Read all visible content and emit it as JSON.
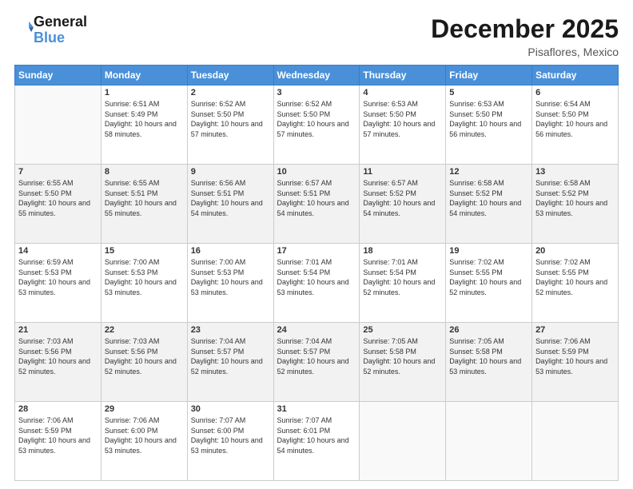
{
  "logo": {
    "line1": "General",
    "line2": "Blue"
  },
  "title": "December 2025",
  "location": "Pisaflores, Mexico",
  "days_of_week": [
    "Sunday",
    "Monday",
    "Tuesday",
    "Wednesday",
    "Thursday",
    "Friday",
    "Saturday"
  ],
  "weeks": [
    [
      {
        "day": "",
        "sunrise": "",
        "sunset": "",
        "daylight": ""
      },
      {
        "day": "1",
        "sunrise": "Sunrise: 6:51 AM",
        "sunset": "Sunset: 5:49 PM",
        "daylight": "Daylight: 10 hours and 58 minutes."
      },
      {
        "day": "2",
        "sunrise": "Sunrise: 6:52 AM",
        "sunset": "Sunset: 5:50 PM",
        "daylight": "Daylight: 10 hours and 57 minutes."
      },
      {
        "day": "3",
        "sunrise": "Sunrise: 6:52 AM",
        "sunset": "Sunset: 5:50 PM",
        "daylight": "Daylight: 10 hours and 57 minutes."
      },
      {
        "day": "4",
        "sunrise": "Sunrise: 6:53 AM",
        "sunset": "Sunset: 5:50 PM",
        "daylight": "Daylight: 10 hours and 57 minutes."
      },
      {
        "day": "5",
        "sunrise": "Sunrise: 6:53 AM",
        "sunset": "Sunset: 5:50 PM",
        "daylight": "Daylight: 10 hours and 56 minutes."
      },
      {
        "day": "6",
        "sunrise": "Sunrise: 6:54 AM",
        "sunset": "Sunset: 5:50 PM",
        "daylight": "Daylight: 10 hours and 56 minutes."
      }
    ],
    [
      {
        "day": "7",
        "sunrise": "Sunrise: 6:55 AM",
        "sunset": "Sunset: 5:50 PM",
        "daylight": "Daylight: 10 hours and 55 minutes."
      },
      {
        "day": "8",
        "sunrise": "Sunrise: 6:55 AM",
        "sunset": "Sunset: 5:51 PM",
        "daylight": "Daylight: 10 hours and 55 minutes."
      },
      {
        "day": "9",
        "sunrise": "Sunrise: 6:56 AM",
        "sunset": "Sunset: 5:51 PM",
        "daylight": "Daylight: 10 hours and 54 minutes."
      },
      {
        "day": "10",
        "sunrise": "Sunrise: 6:57 AM",
        "sunset": "Sunset: 5:51 PM",
        "daylight": "Daylight: 10 hours and 54 minutes."
      },
      {
        "day": "11",
        "sunrise": "Sunrise: 6:57 AM",
        "sunset": "Sunset: 5:52 PM",
        "daylight": "Daylight: 10 hours and 54 minutes."
      },
      {
        "day": "12",
        "sunrise": "Sunrise: 6:58 AM",
        "sunset": "Sunset: 5:52 PM",
        "daylight": "Daylight: 10 hours and 54 minutes."
      },
      {
        "day": "13",
        "sunrise": "Sunrise: 6:58 AM",
        "sunset": "Sunset: 5:52 PM",
        "daylight": "Daylight: 10 hours and 53 minutes."
      }
    ],
    [
      {
        "day": "14",
        "sunrise": "Sunrise: 6:59 AM",
        "sunset": "Sunset: 5:53 PM",
        "daylight": "Daylight: 10 hours and 53 minutes."
      },
      {
        "day": "15",
        "sunrise": "Sunrise: 7:00 AM",
        "sunset": "Sunset: 5:53 PM",
        "daylight": "Daylight: 10 hours and 53 minutes."
      },
      {
        "day": "16",
        "sunrise": "Sunrise: 7:00 AM",
        "sunset": "Sunset: 5:53 PM",
        "daylight": "Daylight: 10 hours and 53 minutes."
      },
      {
        "day": "17",
        "sunrise": "Sunrise: 7:01 AM",
        "sunset": "Sunset: 5:54 PM",
        "daylight": "Daylight: 10 hours and 53 minutes."
      },
      {
        "day": "18",
        "sunrise": "Sunrise: 7:01 AM",
        "sunset": "Sunset: 5:54 PM",
        "daylight": "Daylight: 10 hours and 52 minutes."
      },
      {
        "day": "19",
        "sunrise": "Sunrise: 7:02 AM",
        "sunset": "Sunset: 5:55 PM",
        "daylight": "Daylight: 10 hours and 52 minutes."
      },
      {
        "day": "20",
        "sunrise": "Sunrise: 7:02 AM",
        "sunset": "Sunset: 5:55 PM",
        "daylight": "Daylight: 10 hours and 52 minutes."
      }
    ],
    [
      {
        "day": "21",
        "sunrise": "Sunrise: 7:03 AM",
        "sunset": "Sunset: 5:56 PM",
        "daylight": "Daylight: 10 hours and 52 minutes."
      },
      {
        "day": "22",
        "sunrise": "Sunrise: 7:03 AM",
        "sunset": "Sunset: 5:56 PM",
        "daylight": "Daylight: 10 hours and 52 minutes."
      },
      {
        "day": "23",
        "sunrise": "Sunrise: 7:04 AM",
        "sunset": "Sunset: 5:57 PM",
        "daylight": "Daylight: 10 hours and 52 minutes."
      },
      {
        "day": "24",
        "sunrise": "Sunrise: 7:04 AM",
        "sunset": "Sunset: 5:57 PM",
        "daylight": "Daylight: 10 hours and 52 minutes."
      },
      {
        "day": "25",
        "sunrise": "Sunrise: 7:05 AM",
        "sunset": "Sunset: 5:58 PM",
        "daylight": "Daylight: 10 hours and 52 minutes."
      },
      {
        "day": "26",
        "sunrise": "Sunrise: 7:05 AM",
        "sunset": "Sunset: 5:58 PM",
        "daylight": "Daylight: 10 hours and 53 minutes."
      },
      {
        "day": "27",
        "sunrise": "Sunrise: 7:06 AM",
        "sunset": "Sunset: 5:59 PM",
        "daylight": "Daylight: 10 hours and 53 minutes."
      }
    ],
    [
      {
        "day": "28",
        "sunrise": "Sunrise: 7:06 AM",
        "sunset": "Sunset: 5:59 PM",
        "daylight": "Daylight: 10 hours and 53 minutes."
      },
      {
        "day": "29",
        "sunrise": "Sunrise: 7:06 AM",
        "sunset": "Sunset: 6:00 PM",
        "daylight": "Daylight: 10 hours and 53 minutes."
      },
      {
        "day": "30",
        "sunrise": "Sunrise: 7:07 AM",
        "sunset": "Sunset: 6:00 PM",
        "daylight": "Daylight: 10 hours and 53 minutes."
      },
      {
        "day": "31",
        "sunrise": "Sunrise: 7:07 AM",
        "sunset": "Sunset: 6:01 PM",
        "daylight": "Daylight: 10 hours and 54 minutes."
      },
      {
        "day": "",
        "sunrise": "",
        "sunset": "",
        "daylight": ""
      },
      {
        "day": "",
        "sunrise": "",
        "sunset": "",
        "daylight": ""
      },
      {
        "day": "",
        "sunrise": "",
        "sunset": "",
        "daylight": ""
      }
    ]
  ]
}
